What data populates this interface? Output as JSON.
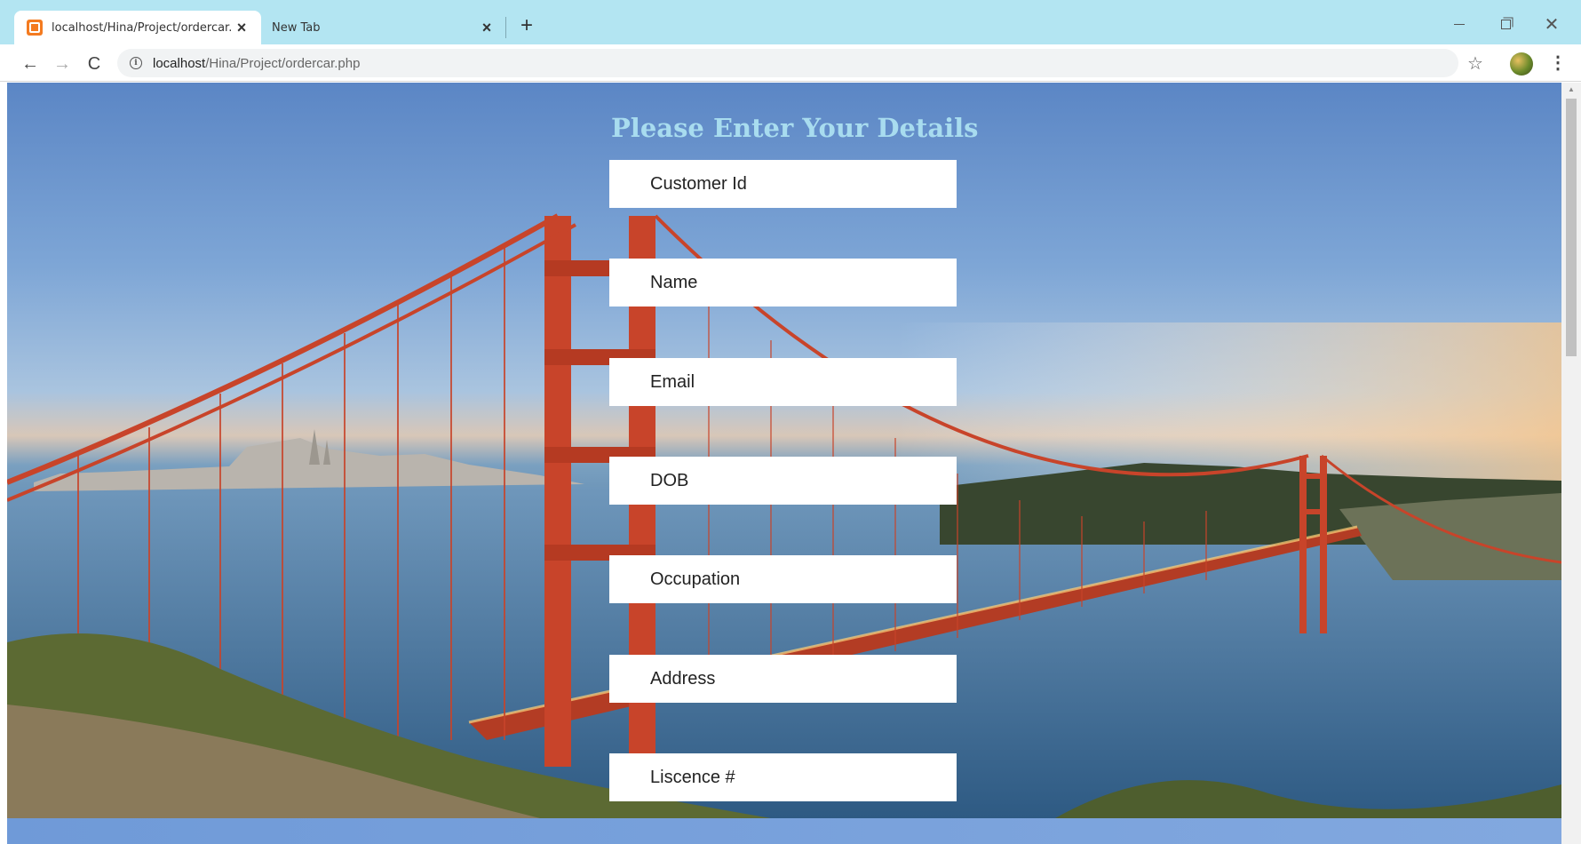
{
  "browser": {
    "tabs": [
      {
        "title": "localhost/Hina/Project/ordercar.php",
        "active": true
      },
      {
        "title": "New Tab",
        "active": false
      }
    ],
    "url": {
      "host": "localhost",
      "path": "/Hina/Project/ordercar.php"
    },
    "icons": {
      "new_tab": "+",
      "tab_close": "×",
      "back": "←",
      "forward": "→",
      "reload": "C",
      "info": "i",
      "star": "☆",
      "menu": "⋮",
      "window_close": "✕"
    }
  },
  "form": {
    "title": "Please Enter Your Details",
    "fields": [
      {
        "placeholder": "Customer Id"
      },
      {
        "placeholder": "Name"
      },
      {
        "placeholder": "Email"
      },
      {
        "placeholder": "DOB"
      },
      {
        "placeholder": "Occupation"
      },
      {
        "placeholder": "Address"
      },
      {
        "placeholder": "Liscence #"
      }
    ]
  },
  "colors": {
    "titlebar": "#b3e5f2",
    "form_title": "#a8dcef",
    "bridge": "#c8442a"
  }
}
